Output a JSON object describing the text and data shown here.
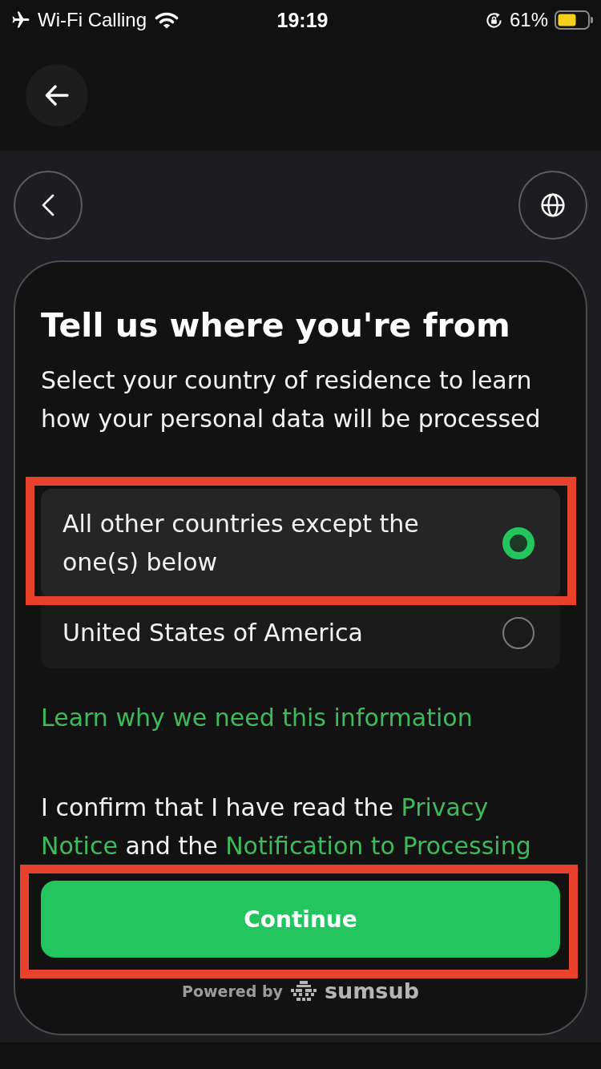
{
  "status_bar": {
    "carrier": "Wi-Fi Calling",
    "time": "19:19",
    "battery": "61%"
  },
  "title": "Tell us where you're from",
  "subtitle": "Select your country of residence to learn how your personal data will be processed",
  "options": [
    {
      "label": "All other countries except the one(s) below",
      "selected": true,
      "highlighted": true
    },
    {
      "label": "United States of America",
      "selected": false,
      "highlighted": false
    }
  ],
  "learn_link": "Learn why we need this information",
  "consent": [
    {
      "kind": "text",
      "text": "I confirm that I have read the"
    },
    {
      "kind": "link",
      "text": "Privacy"
    },
    {
      "kind": "link",
      "text": "Notice"
    },
    {
      "kind": "text",
      "text": "and the"
    },
    {
      "kind": "link",
      "text": "Notification to Processing"
    }
  ],
  "continue_button": {
    "label": "Continue",
    "highlighted": true
  },
  "footer": {
    "powered_by": "Powered by",
    "brand": "sumsub"
  }
}
